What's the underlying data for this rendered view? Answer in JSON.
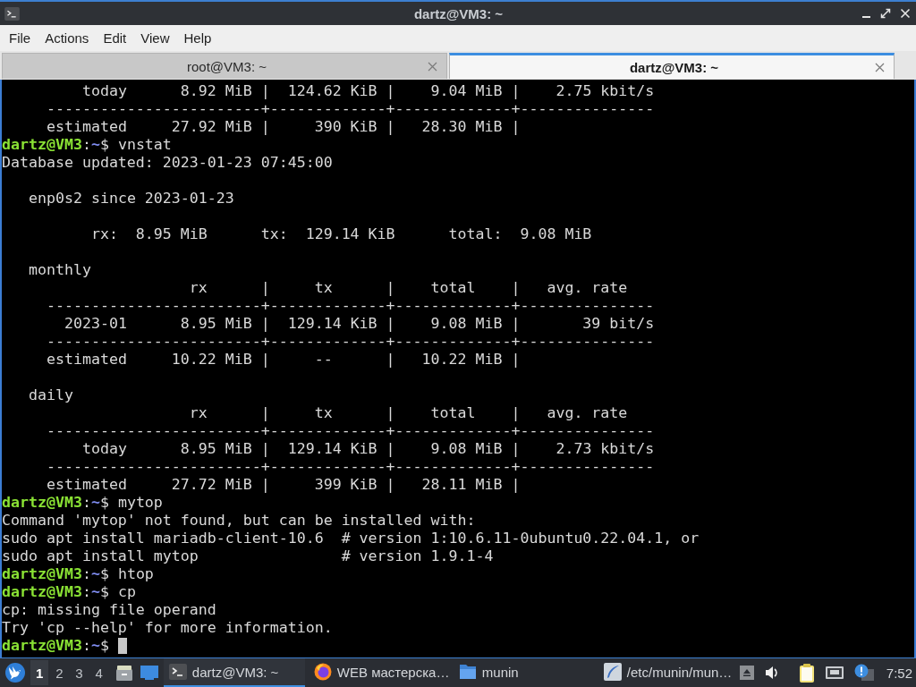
{
  "window": {
    "title": "dartz@VM3: ~"
  },
  "menu": [
    "File",
    "Actions",
    "Edit",
    "View",
    "Help"
  ],
  "tabs": [
    {
      "label": "root@VM3: ~",
      "selected": false
    },
    {
      "label": "dartz@VM3: ~",
      "selected": true
    }
  ],
  "terminal": {
    "lines": [
      {
        "kind": "output",
        "text": "         today      8.92 MiB |  124.62 KiB |    9.04 MiB |    2.75 kbit/s"
      },
      {
        "kind": "output",
        "text": "     ------------------------+-------------+-------------+---------------"
      },
      {
        "kind": "output",
        "text": "     estimated     27.92 MiB |     390 KiB |   28.30 MiB |"
      },
      {
        "kind": "prompt",
        "user_host": "dartz@VM3",
        "separator": ":",
        "path": "~",
        "input": "$ vnstat",
        "cursor": false
      },
      {
        "kind": "output",
        "text": "Database updated: 2023-01-23 07:45:00"
      },
      {
        "kind": "blank"
      },
      {
        "kind": "output",
        "text": "   enp0s2 since 2023-01-23"
      },
      {
        "kind": "blank"
      },
      {
        "kind": "output",
        "text": "          rx:  8.95 MiB      tx:  129.14 KiB      total:  9.08 MiB"
      },
      {
        "kind": "blank"
      },
      {
        "kind": "output",
        "text": "   monthly"
      },
      {
        "kind": "output",
        "text": "                     rx      |     tx      |    total    |   avg. rate"
      },
      {
        "kind": "output",
        "text": "     ------------------------+-------------+-------------+---------------"
      },
      {
        "kind": "output",
        "text": "       2023-01      8.95 MiB |  129.14 KiB |    9.08 MiB |       39 bit/s"
      },
      {
        "kind": "output",
        "text": "     ------------------------+-------------+-------------+---------------"
      },
      {
        "kind": "output",
        "text": "     estimated     10.22 MiB |     --      |   10.22 MiB |"
      },
      {
        "kind": "blank"
      },
      {
        "kind": "output",
        "text": "   daily"
      },
      {
        "kind": "output",
        "text": "                     rx      |     tx      |    total    |   avg. rate"
      },
      {
        "kind": "output",
        "text": "     ------------------------+-------------+-------------+---------------"
      },
      {
        "kind": "output",
        "text": "         today      8.95 MiB |  129.14 KiB |    9.08 MiB |    2.73 kbit/s"
      },
      {
        "kind": "output",
        "text": "     ------------------------+-------------+-------------+---------------"
      },
      {
        "kind": "output",
        "text": "     estimated     27.72 MiB |     399 KiB |   28.11 MiB |"
      },
      {
        "kind": "prompt",
        "user_host": "dartz@VM3",
        "separator": ":",
        "path": "~",
        "input": "$ mytop",
        "cursor": false
      },
      {
        "kind": "output",
        "text": "Command 'mytop' not found, but can be installed with:"
      },
      {
        "kind": "output",
        "text": "sudo apt install mariadb-client-10.6  # version 1:10.6.11-0ubuntu0.22.04.1, or"
      },
      {
        "kind": "output",
        "text": "sudo apt install mytop                # version 1.9.1-4"
      },
      {
        "kind": "prompt",
        "user_host": "dartz@VM3",
        "separator": ":",
        "path": "~",
        "input": "$ htop",
        "cursor": false
      },
      {
        "kind": "prompt",
        "user_host": "dartz@VM3",
        "separator": ":",
        "path": "~",
        "input": "$ cp",
        "cursor": false
      },
      {
        "kind": "output",
        "text": "cp: missing file operand"
      },
      {
        "kind": "output",
        "text": "Try 'cp --help' for more information."
      },
      {
        "kind": "prompt",
        "user_host": "dartz@VM3",
        "separator": ":",
        "path": "~",
        "input": "$ ",
        "cursor": true
      }
    ]
  },
  "taskbar": {
    "workspaces": [
      {
        "label": "1",
        "selected": true
      },
      {
        "label": "2",
        "selected": false
      },
      {
        "label": "3",
        "selected": false
      },
      {
        "label": "4",
        "selected": false
      }
    ],
    "tasks": [
      {
        "kind": "terminal",
        "label": "dartz@VM3: ~",
        "selected": true
      },
      {
        "kind": "browser",
        "label": "WEB мастерска…",
        "selected": false
      },
      {
        "kind": "folder",
        "label": "munin",
        "selected": false
      },
      {
        "kind": "editor",
        "label": "/etc/munin/mun…",
        "selected": false
      }
    ],
    "clock": "7:52"
  }
}
